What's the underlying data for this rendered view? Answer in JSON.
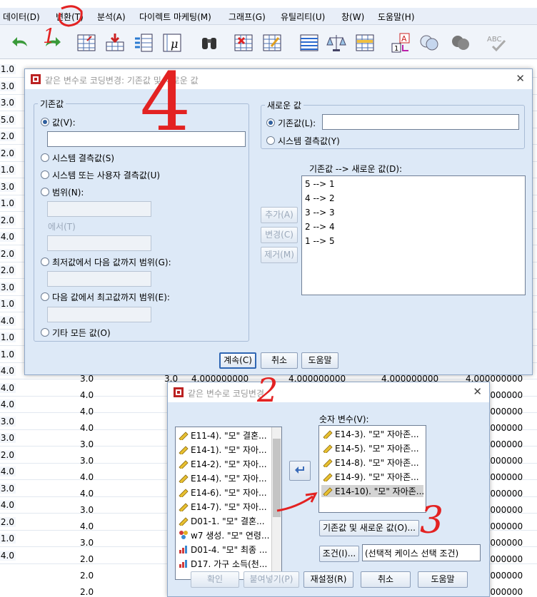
{
  "menu": [
    "데이터(D)",
    "변환(T)",
    "분석(A)",
    "다이렉트 마케팅(M)",
    "그래프(G)",
    "유틸리티(U)",
    "창(W)",
    "도움말(H)"
  ],
  "toolbar_icons": [
    "undo-icon",
    "redo-icon",
    "goto-case-icon",
    "goto-variable-icon",
    "variables-icon",
    "run-descriptive-icon",
    "find-icon",
    "insert-cases-icon",
    "insert-variable-icon",
    "split-file-icon",
    "weight-cases-icon",
    "select-cases-icon",
    "value-labels-icon",
    "use-variable-sets-icon",
    "show-all-variables-icon",
    "spelling-icon"
  ],
  "grid": {
    "row_labels": [
      "1.0",
      "3.0",
      "3.0",
      "5.0",
      "2.0",
      "2.0",
      "1.0",
      "3.0",
      "1.0",
      "2.0",
      "4.0",
      "2.0",
      "2.0",
      "3.0",
      "1.0",
      "4.0",
      "1.0",
      "1.0",
      "4.0",
      "4.0",
      "4.0",
      "3.0",
      "3.0",
      "2.0",
      "4.0",
      "3.0",
      "4.0",
      "2.0",
      "1.0",
      "4.0"
    ],
    "col2_values": [
      "3.0",
      "4.0",
      "4.0",
      "4.0",
      "3.0",
      "3.0",
      "4.0",
      "4.0",
      "3.0",
      "4.0",
      "3.0",
      "2.0",
      "2.0",
      "2.0"
    ],
    "row_top_values": [
      "3.0",
      "4.000000000",
      "4.000000000",
      "4.000000000",
      "4.000000000"
    ],
    "right_col_values": [
      "4.000000000",
      "4.000000000",
      "4.000000000",
      "4.000000000",
      "4.000000000",
      "4.000000000",
      "4.000000000",
      "4.000000000",
      "4.000000000",
      "4.000000000",
      "4.000000000",
      "4.000000000",
      "4.000000000",
      "2.000000000"
    ],
    "bottom_partial": [
      "2.0",
      "1.0",
      "2.0",
      "2.000000000",
      "2.000000000",
      "2.000000000",
      "2.000000000"
    ]
  },
  "old_new_dialog": {
    "title": "같은 변수로 코딩변경: 기존값 및 새로운 값",
    "old_group_label": "기존값",
    "old_options": [
      "값(V):",
      "시스템 결측값(S)",
      "시스템 또는 사용자 결측값(U)",
      "범위(N):",
      "에서(T)",
      "최저값에서 다음 값까지 범위(G):",
      "다음 값에서 최고값까지 범위(E):",
      "기타 모든 값(O)"
    ],
    "new_group_label": "새로운 값",
    "new_options": [
      "기존값(L):",
      "시스템 결측값(Y)"
    ],
    "mapping_label": "기존값 --> 새로운 값(D):",
    "mappings": [
      "5 --> 1",
      "4 --> 2",
      "3 --> 3",
      "2 --> 4",
      "1 --> 5"
    ],
    "side_buttons": [
      "추가(A)",
      "변경(C)",
      "제거(M)"
    ],
    "bottom_buttons": [
      "계속(C)",
      "취소",
      "도움말"
    ]
  },
  "recode_dialog": {
    "title": "같은 변수로 코딩변경",
    "source_vars": [
      "E11-4). \"모\" 결혼...",
      "E14-1). \"모\" 자아...",
      "E14-2). \"모\" 자아...",
      "E14-4). \"모\" 자아...",
      "E14-6). \"모\" 자아...",
      "E14-7). \"모\" 자아...",
      "D01-1. \"모\" 결혼...",
      "w7 생성. \"모\" 연령...",
      "D01-4. \"모\" 최종 ...",
      "D17. 가구 소득(천..."
    ],
    "numeric_label": "숫자 변수(V):",
    "numeric_vars": [
      "E14-3). \"모\" 자아존...",
      "E14-5). \"모\" 자아존...",
      "E14-8). \"모\" 자아존...",
      "E14-9). \"모\" 자아존...",
      "E14-10). \"모\" 자아존..."
    ],
    "old_new_button": "기존값 및 새로운 값(O)...",
    "if_button": "조건(I)...",
    "if_text": "(선택적 케이스 선택 조건)",
    "bottom_buttons": [
      "확인",
      "붙여넣기(P)",
      "재설정(R)",
      "취소",
      "도움말"
    ]
  },
  "annotations": [
    "1",
    "4",
    "2",
    "3"
  ]
}
